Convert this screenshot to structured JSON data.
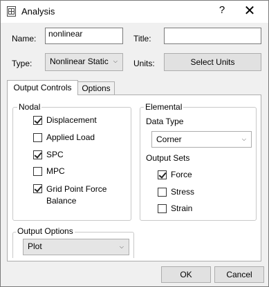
{
  "window": {
    "title": "Analysis",
    "help_label": "?",
    "close_label": "✕"
  },
  "form": {
    "name_label": "Name:",
    "name_value": "nonlinear",
    "title_label": "Title:",
    "title_value": "",
    "type_label": "Type:",
    "type_value": "Nonlinear Static",
    "units_label": "Units:",
    "select_units_label": "Select Units"
  },
  "tabs": [
    {
      "label": "Output Controls",
      "active": true
    },
    {
      "label": "Options",
      "active": false
    }
  ],
  "nodal": {
    "legend": "Nodal",
    "items": [
      {
        "label": "Displacement",
        "checked": true
      },
      {
        "label": "Applied Load",
        "checked": false
      },
      {
        "label": "SPC",
        "checked": true
      },
      {
        "label": "MPC",
        "checked": false
      },
      {
        "label": "Grid Point Force\nBalance",
        "checked": true
      }
    ]
  },
  "elemental": {
    "legend": "Elemental",
    "data_type_label": "Data Type",
    "data_type_value": "Corner",
    "output_sets_label": "Output Sets",
    "items": [
      {
        "label": "Force",
        "checked": true
      },
      {
        "label": "Stress",
        "checked": false
      },
      {
        "label": "Strain",
        "checked": false
      }
    ]
  },
  "output_options": {
    "legend": "Output Options",
    "value": "Plot"
  },
  "footer": {
    "ok_label": "OK",
    "cancel_label": "Cancel"
  },
  "icons": {
    "dropdown": "chevron-down-icon",
    "app": "table-grid-icon"
  }
}
